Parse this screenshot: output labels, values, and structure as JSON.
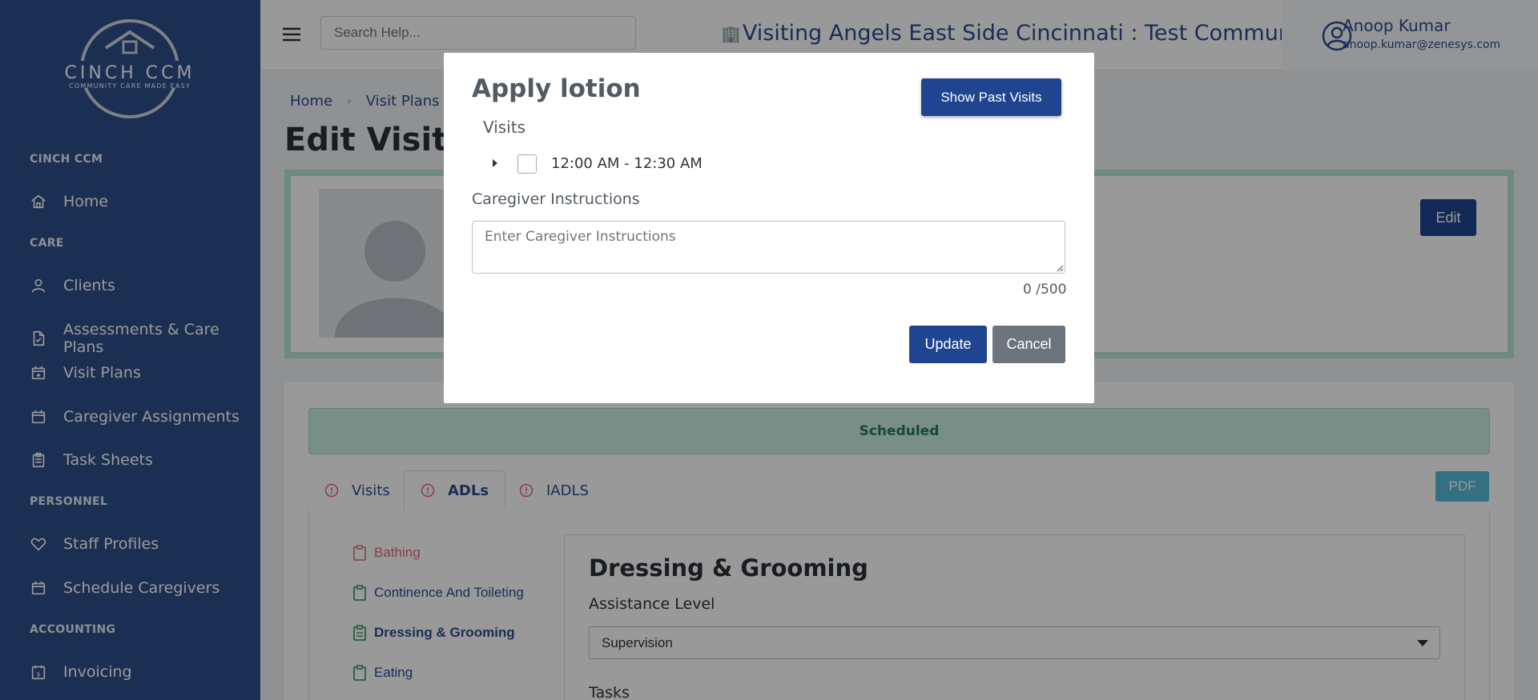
{
  "brand": {
    "name": "CINCH CCM",
    "tagline": "COMMUNITY CARE MADE EASY"
  },
  "sidebar": {
    "sections": [
      {
        "title": "CINCH CCM",
        "items": [
          {
            "label": "Home",
            "icon": "home-icon"
          }
        ]
      },
      {
        "title": "CARE",
        "items": [
          {
            "label": "Clients",
            "icon": "user-icon"
          },
          {
            "label": "Assessments & Care Plans",
            "icon": "document-icon"
          },
          {
            "label": "Visit Plans",
            "icon": "calendar-plus-icon"
          },
          {
            "label": "Caregiver Assignments",
            "icon": "calendar-icon"
          },
          {
            "label": "Task Sheets",
            "icon": "clipboard-icon"
          }
        ]
      },
      {
        "title": "PERSONNEL",
        "items": [
          {
            "label": "Staff Profiles",
            "icon": "heart-icon"
          },
          {
            "label": "Schedule Caregivers",
            "icon": "calendar-icon"
          }
        ]
      },
      {
        "title": "ACCOUNTING",
        "items": [
          {
            "label": "Invoicing",
            "icon": "invoice-icon"
          }
        ]
      }
    ]
  },
  "topbar": {
    "search_placeholder": "Search Help...",
    "community": "Visiting Angels East Side Cincinnati : Test Community",
    "user_name": "Anoop Kumar",
    "user_email": "anoop.kumar@zenesys.com"
  },
  "main": {
    "breadcrumb": [
      "Home",
      "Visit Plans"
    ],
    "page_title": "Edit Visit Pl",
    "edit_label": "Edit",
    "status": "Scheduled",
    "tabs": [
      "Visits",
      "ADLs",
      "IADLS"
    ],
    "pdf_label": "PDF",
    "adl_items": [
      {
        "label": "Bathing",
        "color": "#e06a78"
      },
      {
        "label": "Continence And Toileting",
        "color": "#2a8c5a"
      },
      {
        "label": "Dressing & Grooming",
        "color": "#2a8c5a"
      },
      {
        "label": "Eating",
        "color": "#2a8c5a"
      }
    ],
    "detail_title": "Dressing & Grooming",
    "assistance_label": "Assistance Level",
    "assistance_value": "Supervision",
    "tasks_label": "Tasks"
  },
  "modal": {
    "title": "Apply lotion",
    "show_past_label": "Show Past Visits",
    "visits_label": "Visits",
    "visit_time": "12:00 AM - 12:30 AM",
    "instructions_label": "Caregiver Instructions",
    "instructions_placeholder": "Enter Caregiver Instructions",
    "counter": "0 /500",
    "update_label": "Update",
    "cancel_label": "Cancel"
  },
  "colors": {
    "sidebar": "#2e4f8a",
    "primary": "#1f4591",
    "status_bg": "#c9ede0",
    "status_text": "#2a7a53"
  }
}
